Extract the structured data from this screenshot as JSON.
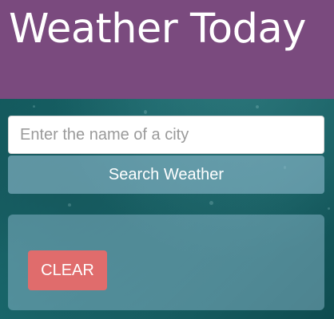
{
  "header": {
    "title": "Weather Today",
    "background_color": "#7a4a7e"
  },
  "search": {
    "placeholder": "Enter the name of a city",
    "value": "",
    "button_label": "Search Weather"
  },
  "results": {
    "clear_label": "CLEAR",
    "clear_color": "#e06c6c"
  }
}
